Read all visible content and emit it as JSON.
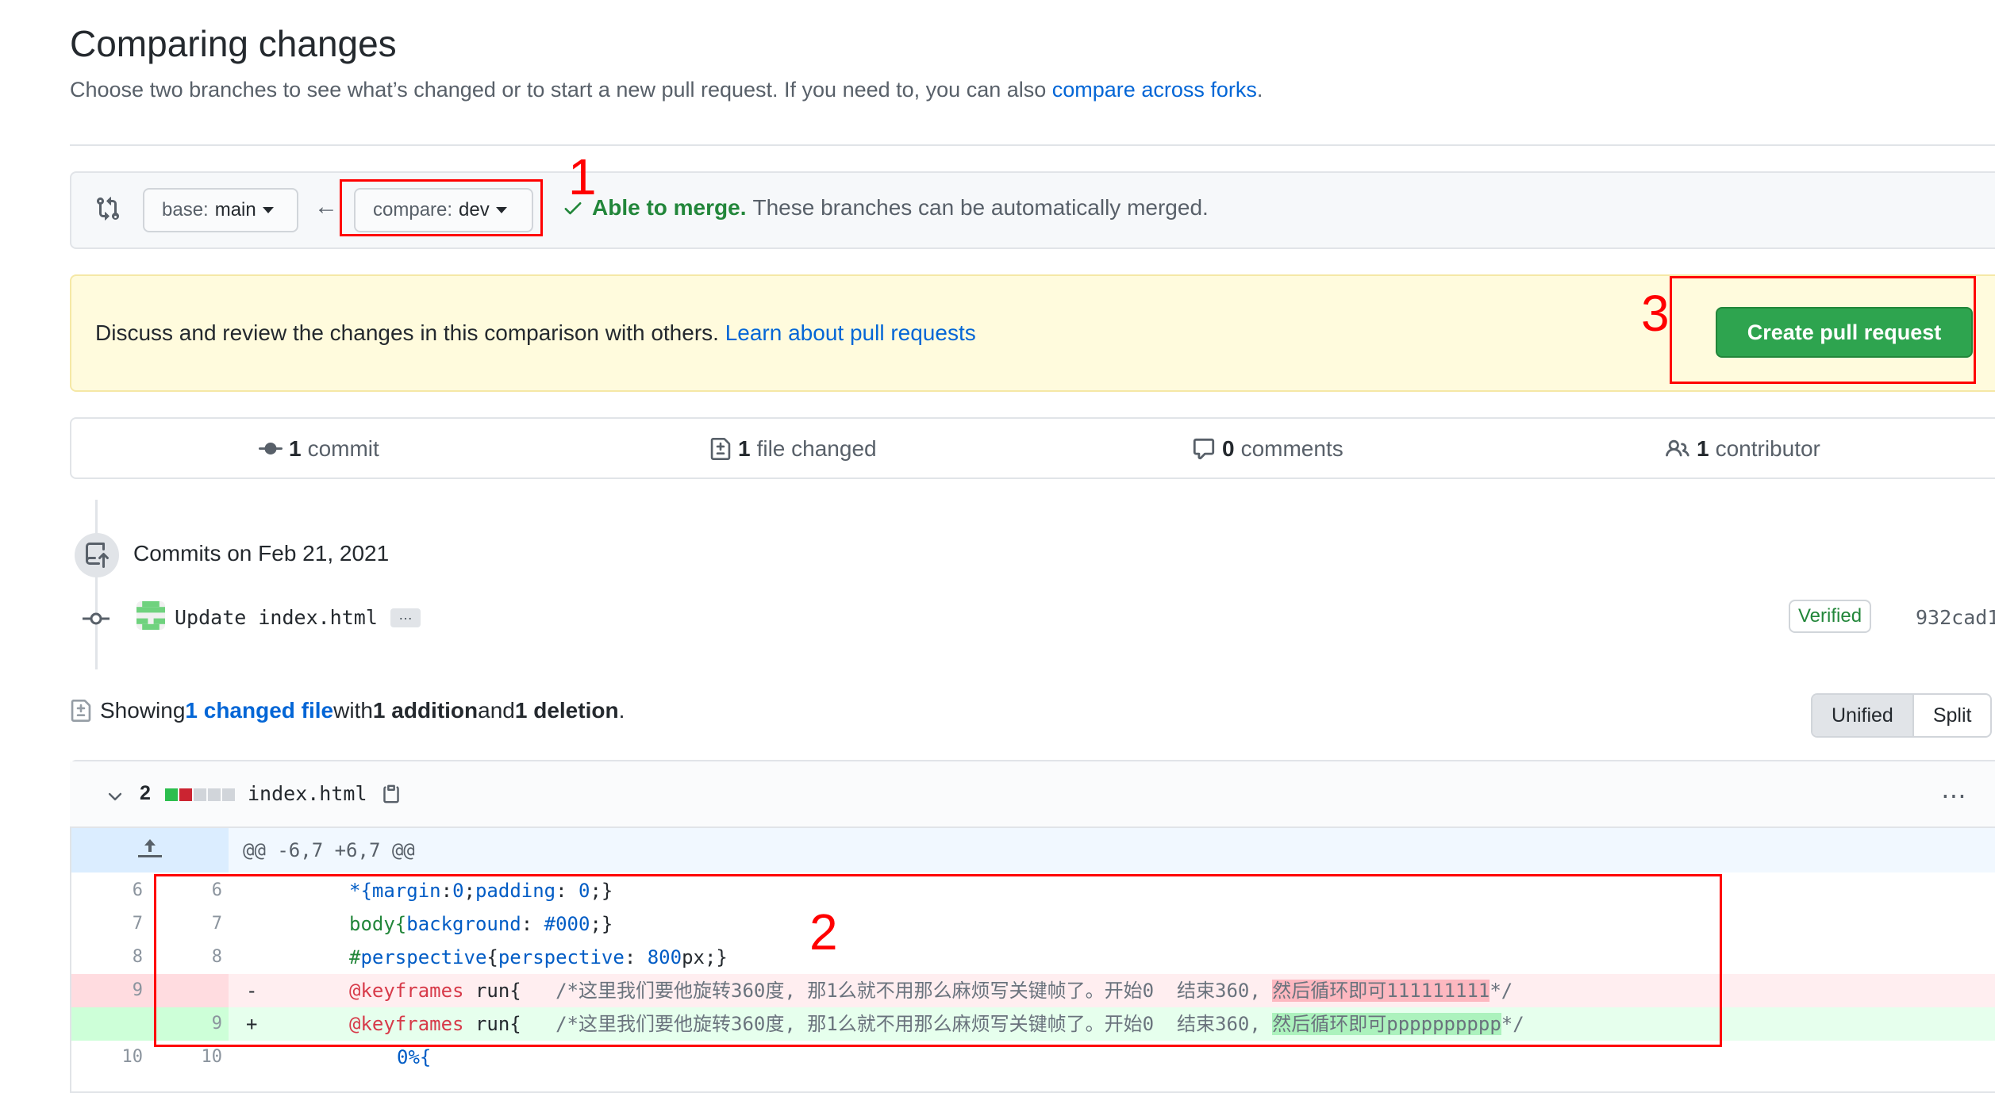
{
  "header": {
    "title": "Comparing changes",
    "subtitle": "Choose two branches to see what’s changed or to start a new pull request. If you need to, you can also ",
    "subtitle_link": "compare across forks",
    "subtitle_end": "."
  },
  "compare": {
    "base_label": "base:",
    "base_value": "main",
    "compare_label": "compare:",
    "compare_value": "dev",
    "arrow": "←",
    "merge_ok": "Able to merge.",
    "merge_msg": "These branches can be automatically merged."
  },
  "flash": {
    "text": "Discuss and review the changes in this comparison with others. ",
    "link": "Learn about pull requests",
    "button": "Create pull request"
  },
  "stats": {
    "commits_n": "1",
    "commits_label": "commit",
    "files_n": "1",
    "files_label": "file changed",
    "comments_n": "0",
    "comments_label": "comments",
    "contributors_n": "1",
    "contributors_label": "contributor"
  },
  "commits": {
    "date_label": "Commits on Feb 21, 2021",
    "message": "Update index.html",
    "more": "…",
    "verified": "Verified",
    "sha": "932cad1"
  },
  "showing": {
    "prefix": "Showing ",
    "link": "1 changed file",
    "mid": " with ",
    "additions": "1 addition",
    "and": " and ",
    "deletions": "1 deletion",
    "end": "."
  },
  "view_toggle": {
    "unified": "Unified",
    "split": "Split"
  },
  "diff": {
    "count": "2",
    "filename": "index.html",
    "hunk": "@@ -6,7 +6,7 @@",
    "rows": [
      {
        "old": "6",
        "new": "6"
      },
      {
        "old": "7",
        "new": "7"
      },
      {
        "old": "8",
        "new": "8"
      },
      {
        "old": "9",
        "new": "",
        "sign": "-"
      },
      {
        "old": "",
        "new": "9",
        "sign": "+"
      },
      {
        "old": "10",
        "new": "10"
      }
    ],
    "line1_a": "*{",
    "line1_b": "margin",
    "line1_c": ":",
    "line1_d": "0",
    "line1_e": ";",
    "line1_f": "padding",
    "line1_g": ": ",
    "line1_h": "0",
    "line1_i": ";}",
    "line2_a": "body{",
    "line2_b": "background",
    "line2_c": ": ",
    "line2_d": "#000",
    "line2_e": ";}",
    "line3_a": "#",
    "line3_b": "perspective",
    "line3_c": "{",
    "line3_d": "perspective",
    "line3_e": ": ",
    "line3_f": "800",
    "line3_g": "px;}",
    "del_kw": "@keyframes",
    "del_mid": " run{   ",
    "del_cm": "/*这里我们要他旋转360度, 那1么就不用那么麻烦写关键帧了。开始0  结束360, ",
    "del_hl": "然后循环即可111111111",
    "del_end": "*/",
    "add_kw": "@keyframes",
    "add_mid": " run{   ",
    "add_cm": "/*这里我们要他旋转360度, 那1么就不用那么麻烦写关键帧了。开始0  结束360, ",
    "add_hl": "然后循环即可pppppppppp",
    "add_end": "*/",
    "line6": "0%{"
  },
  "annotations": {
    "a1": "1",
    "a2": "2",
    "a3": "3"
  },
  "colors": {
    "accent": "#0366d6",
    "success": "#2ea44f",
    "annotation": "#ff0000"
  }
}
